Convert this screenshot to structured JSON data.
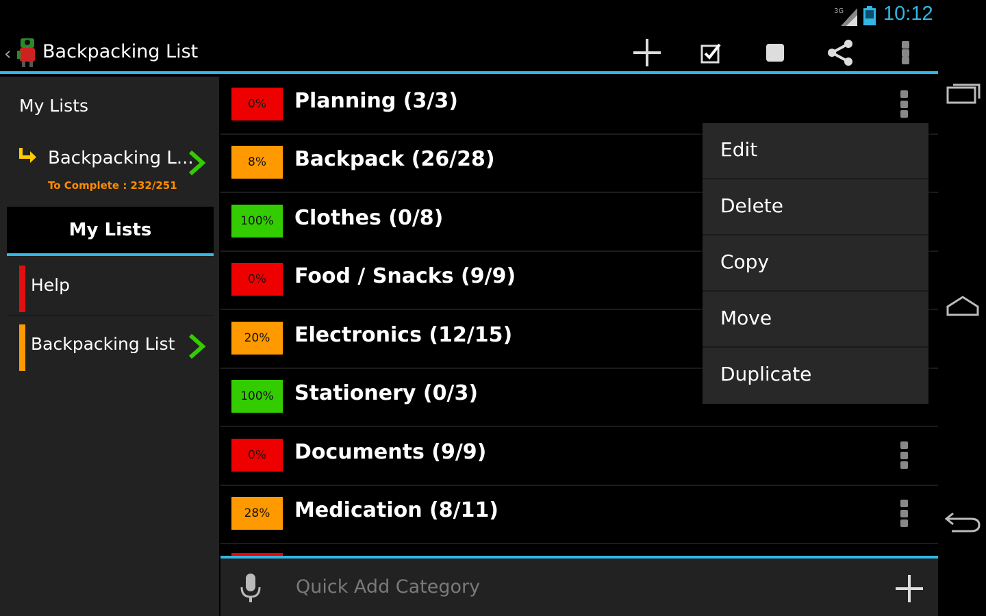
{
  "status": {
    "time": "10:12",
    "network": "3G"
  },
  "actionbar": {
    "title": "Backpacking List",
    "actions": [
      "add-icon",
      "check-icon",
      "stop-icon",
      "share-icon",
      "overflow-icon"
    ]
  },
  "drawer": {
    "header": "My Lists",
    "current": {
      "label": "Backpacking L...",
      "sub": "To Complete : 232/251"
    },
    "tab": "My Lists",
    "items": [
      {
        "label": "Help",
        "color": "#e01010"
      },
      {
        "label": "Backpacking List",
        "color": "#ff9900"
      }
    ]
  },
  "categories": [
    {
      "pct": "0%",
      "name": "Planning (3/3)",
      "color": "#ee0000"
    },
    {
      "pct": "8%",
      "name": "Backpack (26/28)",
      "color": "#ff9900"
    },
    {
      "pct": "100%",
      "name": "Clothes (0/8)",
      "color": "#33cc00"
    },
    {
      "pct": "0%",
      "name": "Food / Snacks (9/9)",
      "color": "#ee0000"
    },
    {
      "pct": "20%",
      "name": "Electronics (12/15)",
      "color": "#ff9900"
    },
    {
      "pct": "100%",
      "name": "Stationery (0/3)",
      "color": "#33cc00"
    },
    {
      "pct": "0%",
      "name": "Documents (9/9)",
      "color": "#ee0000"
    },
    {
      "pct": "28%",
      "name": "Medication (8/11)",
      "color": "#ff9900"
    }
  ],
  "popup": {
    "items": [
      "Edit",
      "Delete",
      "Copy",
      "Move",
      "Duplicate"
    ]
  },
  "quickadd": {
    "placeholder": "Quick Add Category"
  },
  "colors": {
    "accent": "#33b5e5",
    "drawer_bg": "#222222"
  }
}
